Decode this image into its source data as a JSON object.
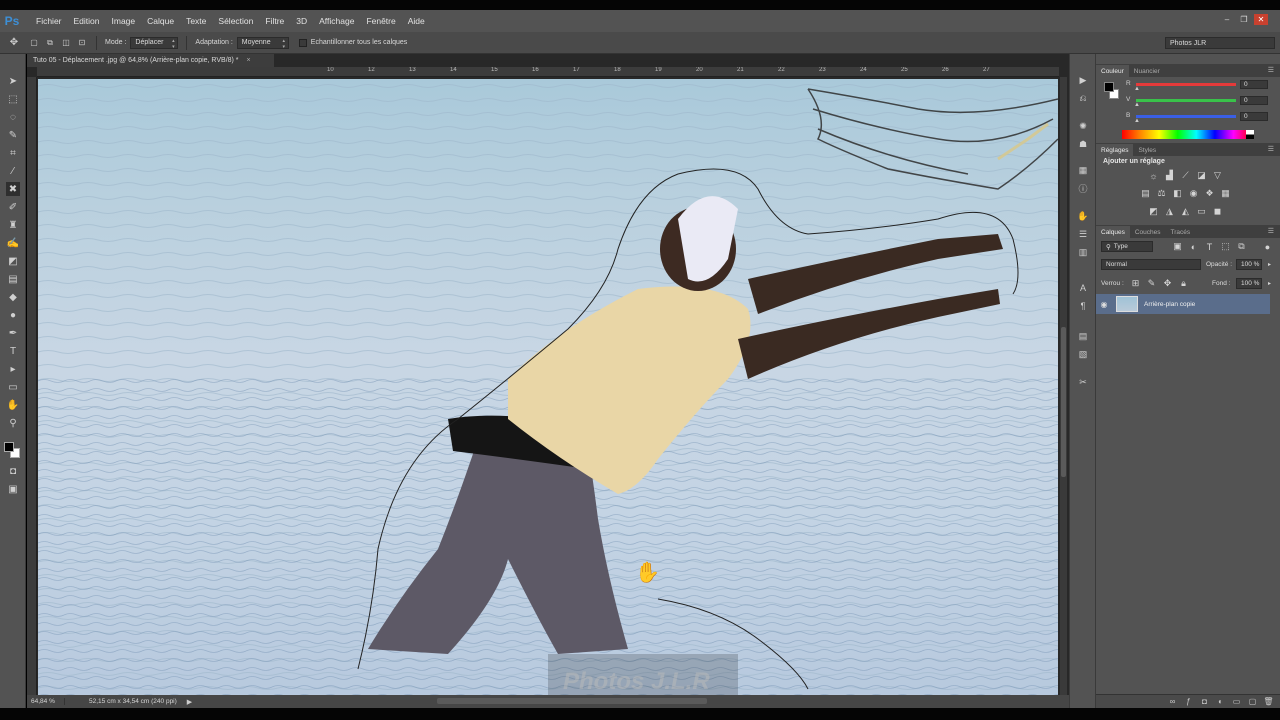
{
  "app": {
    "logo": "Ps"
  },
  "menu": [
    "Fichier",
    "Edition",
    "Image",
    "Calque",
    "Texte",
    "Sélection",
    "Filtre",
    "3D",
    "Affichage",
    "Fenêtre",
    "Aide"
  ],
  "window_controls": {
    "minimize": "‒",
    "restore": "❐",
    "close": "✕"
  },
  "options": {
    "mode_label": "Mode :",
    "mode_value": "Déplacer",
    "adaptation_label": "Adaptation :",
    "adaptation_value": "Moyenne",
    "sample_all_label": "Echantillonner tous les calques",
    "workspace": "Photos JLR"
  },
  "document": {
    "tab_title": "Tuto 05 - Déplacement .jpg @ 64,8% (Arrière-plan copie, RVB/8) *",
    "tab_close": "×",
    "ruler_ticks": [
      "10",
      "12",
      "13",
      "14",
      "15",
      "16",
      "17",
      "18",
      "19",
      "20",
      "21",
      "22",
      "23",
      "24",
      "25",
      "26",
      "27"
    ],
    "zoom": "64,84 %",
    "doc_info": "52,15 cm x 34,54 cm (240 ppi)",
    "watermark": "Photos J.L.R"
  },
  "panels": {
    "color": {
      "tab_active": "Couleur",
      "tab_other": "Nuancier",
      "r_label": "R",
      "v_label": "V",
      "b_label": "B",
      "r_value": "0",
      "v_value": "0",
      "b_value": "0",
      "r_color": "#e53a3a",
      "v_color": "#39c24a",
      "b_color": "#3a5fe5"
    },
    "adjustments": {
      "tab_active": "Réglages",
      "tab_other": "Styles",
      "title": "Ajouter un réglage"
    },
    "layers": {
      "tab_active": "Calques",
      "tab_channels": "Couches",
      "tab_paths": "Tracés",
      "filter_type": "Type",
      "blend_mode": "Normal",
      "opacity_label": "Opacité :",
      "opacity_value": "100 %",
      "lock_label": "Verrou :",
      "fill_label": "Fond :",
      "fill_value": "100 %",
      "layer_name": "Arrière-plan copie"
    }
  }
}
